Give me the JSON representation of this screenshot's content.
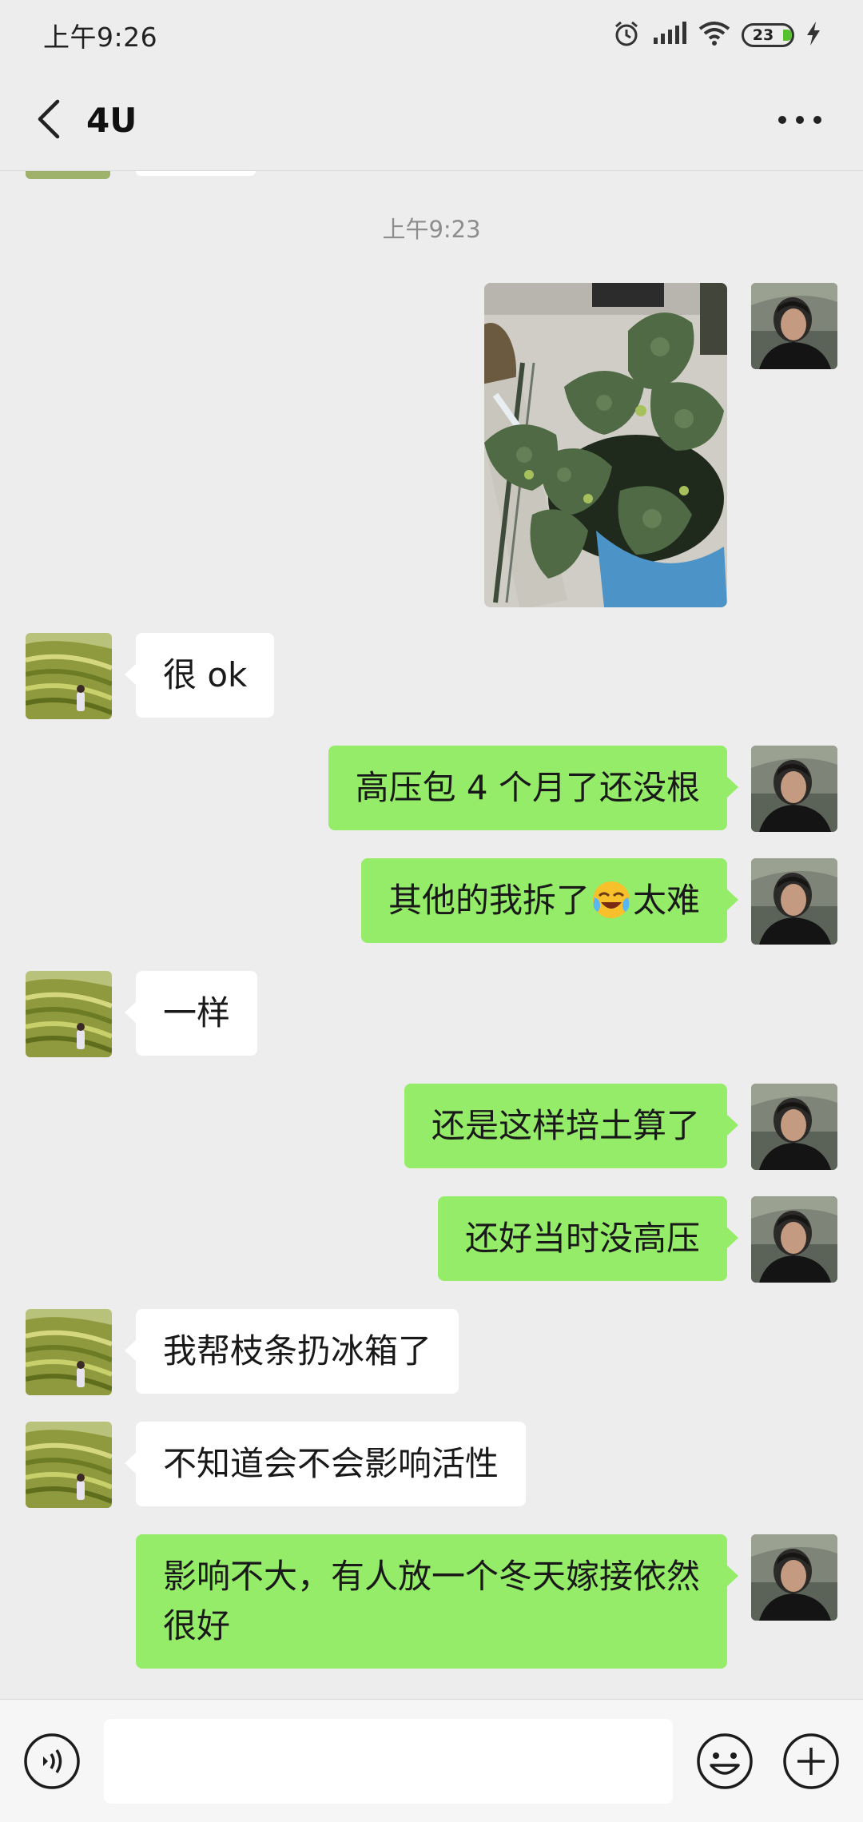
{
  "status_bar": {
    "time": "上午9:26",
    "battery": "23",
    "icons": [
      "alarm-icon",
      "signal-icon",
      "wifi-icon",
      "battery-icon",
      "charging-icon"
    ]
  },
  "header": {
    "back_icon": "chevron-left-icon",
    "title": "4U",
    "more_icon": "more-dots-icon"
  },
  "chat": {
    "time_divider": "上午9:23",
    "messages": [
      {
        "side": "right",
        "type": "image",
        "content": "fig-plant-photo"
      },
      {
        "side": "left",
        "type": "text",
        "text": "很 ok"
      },
      {
        "side": "right",
        "type": "text",
        "text": "高压包 4 个月了还没根"
      },
      {
        "side": "right",
        "type": "text",
        "text_before": "其他的我拆了",
        "emoji": "laughing-crying-emoji",
        "text_after": "太难"
      },
      {
        "side": "left",
        "type": "text",
        "text": "一样"
      },
      {
        "side": "right",
        "type": "text",
        "text": "还是这样培土算了"
      },
      {
        "side": "right",
        "type": "text",
        "text": "还好当时没高压"
      },
      {
        "side": "left",
        "type": "text",
        "text": "我帮枝条扔冰箱了"
      },
      {
        "side": "left",
        "type": "text",
        "text": "不知道会不会影响活性"
      },
      {
        "side": "right",
        "type": "text",
        "text": "影响不大，有人放一个冬天嫁接依然很好"
      }
    ]
  },
  "input_bar": {
    "voice_icon": "voice-icon",
    "input_value": "",
    "emoji_icon": "emoji-icon",
    "plus_icon": "plus-icon"
  },
  "colors": {
    "background": "#ededed",
    "right_bubble": "#95ec69",
    "left_bubble": "#ffffff",
    "time_text": "#8d8d8d"
  }
}
